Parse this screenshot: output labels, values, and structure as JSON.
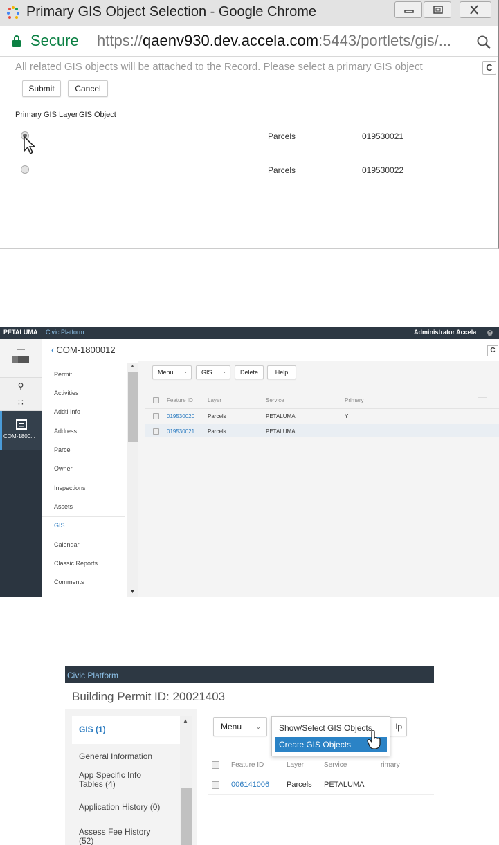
{
  "popup": {
    "window_title": "Primary GIS Object Selection - Google Chrome",
    "secure_label": "Secure",
    "url_scheme": "https://",
    "url_host": "qaenv930.dev.accela.com",
    "url_rest": ":5443/portlets/gis/...",
    "notice": "All related GIS objects will be attached to the Record. Please select a primary GIS object",
    "submit_label": "Submit",
    "cancel_label": "Cancel",
    "columns": [
      "Primary",
      "GIS Layer",
      "GIS Object"
    ],
    "rows": [
      {
        "selected": true,
        "layer": "Parcels",
        "object": "019530021"
      },
      {
        "selected": false,
        "layer": "Parcels",
        "object": "019530022"
      }
    ],
    "refresh_glyph": "C"
  },
  "record": {
    "brand": "PETALUMA",
    "product": "Civic Platform",
    "user": "Administrator Accela",
    "back_label": "COM-1800012",
    "nav_record_label": "COM-1800...",
    "side_items": [
      "Permit",
      "Activities",
      "Addtl Info",
      "Address",
      "Parcel",
      "Owner",
      "Inspections",
      "Assets",
      "GIS",
      "Calendar",
      "Classic Reports",
      "Comments"
    ],
    "active_item": "GIS",
    "toolbar": {
      "menu": "Menu",
      "gis": "GIS",
      "delete": "Delete",
      "help": "Help"
    },
    "columns": [
      "Feature ID",
      "Layer",
      "Service",
      "Primary"
    ],
    "rows": [
      {
        "feature_id": "019530020",
        "layer": "Parcels",
        "service": "PETALUMA",
        "primary": "Y"
      },
      {
        "feature_id": "019530021",
        "layer": "Parcels",
        "service": "PETALUMA",
        "primary": ""
      }
    ],
    "refresh_glyph": "C"
  },
  "permit": {
    "product": "Civic Platform",
    "title": "Building Permit ID: 20021403",
    "side_items": [
      "GIS (1)",
      "General Information",
      "App Specific Info Tables (4)",
      "Application History (0)",
      "Assess Fee History (52)"
    ],
    "menu_label": "Menu",
    "help_label_partial": "lp",
    "dropdown": [
      "Show/Select GIS Objects",
      "Create GIS Objects"
    ],
    "columns": [
      "Feature ID",
      "Layer",
      "Service",
      "Primary"
    ],
    "columns_partial": [
      "Feature ID",
      "Layer",
      "Service",
      "rimary"
    ],
    "rows": [
      {
        "feature_id": "006141006",
        "layer": "Parcels",
        "service": "PETALUMA"
      }
    ]
  },
  "colors": {
    "accent": "#2b83c6",
    "link": "#2b7bc0",
    "topbar": "#2d3843",
    "secure": "#0b8043"
  },
  "icons": [
    "chrome-logo-icon",
    "lock-icon",
    "zoom-icon",
    "minimize-icon",
    "maximize-icon",
    "close-icon",
    "refresh-icon",
    "cursor-arrow-icon",
    "hamburger-icon",
    "search-icon",
    "apps-grid-icon",
    "record-icon",
    "gear-icon",
    "chevron-left-icon",
    "chevron-down-icon",
    "hand-cursor-icon"
  ]
}
